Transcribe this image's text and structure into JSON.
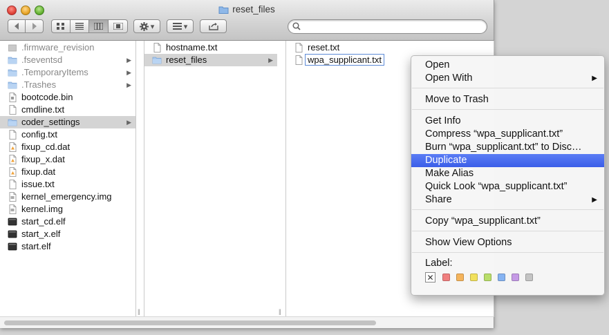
{
  "window": {
    "title": "reset_files"
  },
  "toolbar": {
    "view_modes": [
      "icon-view",
      "list-view",
      "column-view",
      "coverflow-view"
    ],
    "active_view": "column-view",
    "search": {
      "value": "",
      "placeholder": ""
    }
  },
  "columns": {
    "col1": [
      {
        "label": ".firmware_revision",
        "kind": "file-gray",
        "dim": true,
        "folder": false
      },
      {
        "label": ".fseventsd",
        "kind": "folder",
        "dim": true,
        "folder": true
      },
      {
        "label": ".TemporaryItems",
        "kind": "folder",
        "dim": true,
        "folder": true
      },
      {
        "label": ".Trashes",
        "kind": "folder",
        "dim": true,
        "folder": true
      },
      {
        "label": "bootcode.bin",
        "kind": "binary",
        "dim": false,
        "folder": false
      },
      {
        "label": "cmdline.txt",
        "kind": "text",
        "dim": false,
        "folder": false
      },
      {
        "label": "coder_settings",
        "kind": "folder",
        "dim": false,
        "folder": true,
        "selected": true
      },
      {
        "label": "config.txt",
        "kind": "text",
        "dim": false,
        "folder": false
      },
      {
        "label": "fixup_cd.dat",
        "kind": "dat",
        "dim": false,
        "folder": false
      },
      {
        "label": "fixup_x.dat",
        "kind": "dat",
        "dim": false,
        "folder": false
      },
      {
        "label": "fixup.dat",
        "kind": "dat",
        "dim": false,
        "folder": false
      },
      {
        "label": "issue.txt",
        "kind": "text",
        "dim": false,
        "folder": false
      },
      {
        "label": "kernel_emergency.img",
        "kind": "img",
        "dim": false,
        "folder": false
      },
      {
        "label": "kernel.img",
        "kind": "img",
        "dim": false,
        "folder": false
      },
      {
        "label": "start_cd.elf",
        "kind": "exec",
        "dim": false,
        "folder": false
      },
      {
        "label": "start_x.elf",
        "kind": "exec",
        "dim": false,
        "folder": false
      },
      {
        "label": "start.elf",
        "kind": "exec",
        "dim": false,
        "folder": false
      }
    ],
    "col2": [
      {
        "label": "hostname.txt",
        "kind": "text",
        "dim": false,
        "folder": false
      },
      {
        "label": "reset_files",
        "kind": "folder",
        "dim": false,
        "folder": true,
        "selected": true
      }
    ],
    "col3": [
      {
        "label": "reset.txt",
        "kind": "text",
        "dim": false,
        "folder": false
      },
      {
        "label": "wpa_supplicant.txt",
        "kind": "text",
        "dim": false,
        "folder": false,
        "outlined": true
      }
    ]
  },
  "context_menu": {
    "items": [
      {
        "label": "Open",
        "group": 0
      },
      {
        "label": "Open With",
        "group": 0,
        "submenu": true
      },
      {
        "label": "Move to Trash",
        "group": 1
      },
      {
        "label": "Get Info",
        "group": 2
      },
      {
        "label": "Compress “wpa_supplicant.txt”",
        "group": 2
      },
      {
        "label": "Burn “wpa_supplicant.txt” to Disc…",
        "group": 2
      },
      {
        "label": "Duplicate",
        "group": 2,
        "highlighted": true
      },
      {
        "label": "Make Alias",
        "group": 2
      },
      {
        "label": "Quick Look “wpa_supplicant.txt”",
        "group": 2
      },
      {
        "label": "Share",
        "group": 2,
        "submenu": true
      },
      {
        "label": "Copy “wpa_supplicant.txt”",
        "group": 3
      },
      {
        "label": "Show View Options",
        "group": 4
      }
    ],
    "label_title": "Label:",
    "label_colors": [
      {
        "name": "red",
        "color": "#f07f7f"
      },
      {
        "name": "orange",
        "color": "#f5b45c"
      },
      {
        "name": "yellow",
        "color": "#f2e15d"
      },
      {
        "name": "green",
        "color": "#b9de6a"
      },
      {
        "name": "blue",
        "color": "#86b3f2"
      },
      {
        "name": "purple",
        "color": "#c59ae6"
      },
      {
        "name": "gray",
        "color": "#c4c4c4"
      }
    ]
  },
  "colors": {
    "menu_highlight": "#3b5ee8",
    "selection_gray": "#d4d4d4"
  }
}
